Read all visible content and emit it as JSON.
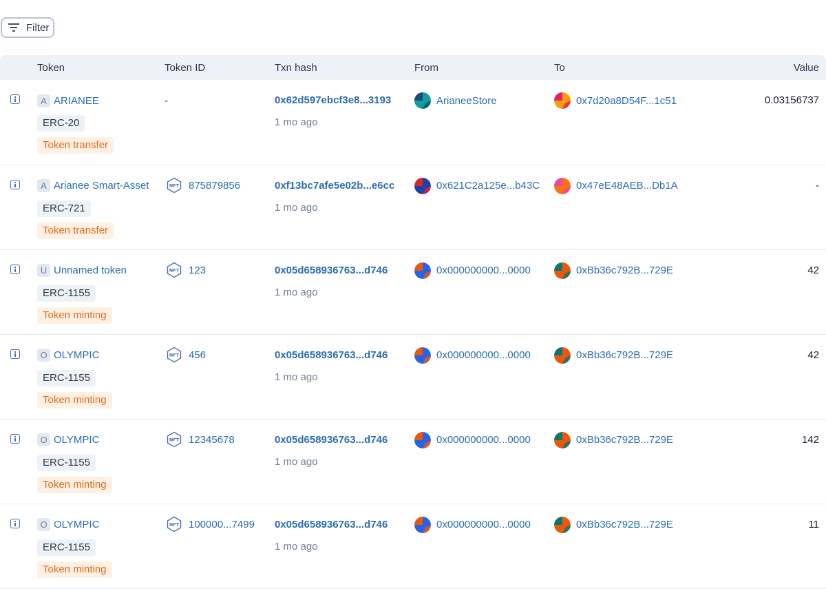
{
  "filter": {
    "label": "Filter"
  },
  "table": {
    "headers": {
      "token": "Token",
      "token_id": "Token ID",
      "txn_hash": "Txn hash",
      "from": "From",
      "to": "To",
      "value": "Value"
    },
    "rows": [
      {
        "token_letter": "A",
        "token_name": "ARIANEE",
        "standard": "ERC-20",
        "method": "Token transfer",
        "token_id": "-",
        "has_nft": false,
        "hash": "0x62d597ebcf3e8...3193",
        "age": "1 mo ago",
        "from": "ArianeeStore",
        "to": "0x7d20a8D54F...1c51",
        "value": "0.03156737",
        "from_colors": [
          "#0e9f9a",
          "#1c4b7a"
        ],
        "to_colors": [
          "#f59e0b",
          "#e91e63"
        ]
      },
      {
        "token_letter": "A",
        "token_name": "Arianee Smart-Asset",
        "standard": "ERC-721",
        "method": "Token transfer",
        "token_id": "875879856",
        "has_nft": true,
        "hash": "0xf13bc7afe5e02b...e6cc",
        "age": "1 mo ago",
        "from": "0x621C2a125e...b43C",
        "to": "0x47eE48AEB...Db1A",
        "value": "-",
        "from_colors": [
          "#1e40af",
          "#dc2626"
        ],
        "to_colors": [
          "#f97316",
          "#ec4899"
        ]
      },
      {
        "token_letter": "U",
        "token_name": "Unnamed token",
        "standard": "ERC-1155",
        "method": "Token minting",
        "token_id": "123",
        "has_nft": true,
        "hash": "0x05d658936763...d746",
        "age": "1 mo ago",
        "from": "0x000000000...0000",
        "to": "0xBb36c792B...729E",
        "value": "42",
        "from_colors": [
          "#2563eb",
          "#ea580c"
        ],
        "to_colors": [
          "#ea580c",
          "#0f766e"
        ]
      },
      {
        "token_letter": "O",
        "token_name": "OLYMPIC",
        "standard": "ERC-1155",
        "method": "Token minting",
        "token_id": "456",
        "has_nft": true,
        "hash": "0x05d658936763...d746",
        "age": "1 mo ago",
        "from": "0x000000000...0000",
        "to": "0xBb36c792B...729E",
        "value": "42",
        "from_colors": [
          "#2563eb",
          "#ea580c"
        ],
        "to_colors": [
          "#ea580c",
          "#0f766e"
        ]
      },
      {
        "token_letter": "O",
        "token_name": "OLYMPIC",
        "standard": "ERC-1155",
        "method": "Token minting",
        "token_id": "12345678",
        "has_nft": true,
        "hash": "0x05d658936763...d746",
        "age": "1 mo ago",
        "from": "0x000000000...0000",
        "to": "0xBb36c792B...729E",
        "value": "142",
        "from_colors": [
          "#2563eb",
          "#ea580c"
        ],
        "to_colors": [
          "#ea580c",
          "#0f766e"
        ]
      },
      {
        "token_letter": "O",
        "token_name": "OLYMPIC",
        "standard": "ERC-1155",
        "method": "Token minting",
        "token_id": "100000...7499",
        "has_nft": true,
        "hash": "0x05d658936763...d746",
        "age": "1 mo ago",
        "from": "0x000000000...0000",
        "to": "0xBb36c792B...729E",
        "value": "11",
        "from_colors": [
          "#2563eb",
          "#ea580c"
        ],
        "to_colors": [
          "#ea580c",
          "#0f766e"
        ]
      }
    ]
  },
  "icons": {
    "filter": "filter-lines-icon",
    "info": "info-icon",
    "nft": "nft-hexagon-icon"
  }
}
